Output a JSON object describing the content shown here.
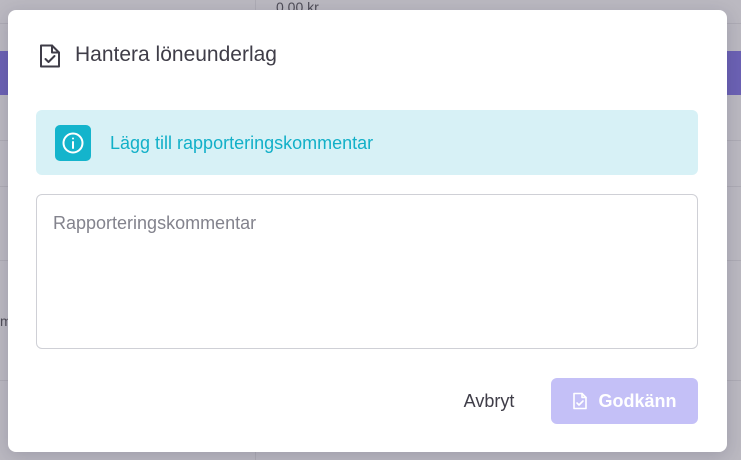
{
  "background": {
    "amount_text": "0,00 kr",
    "partial_text": "m"
  },
  "modal": {
    "title": "Hantera löneunderlag",
    "title_icon": "file-check-icon",
    "info_banner": {
      "icon": "info-circle-icon",
      "text": "Lägg till rapporteringskommentar"
    },
    "comment_field": {
      "placeholder": "Rapporteringskommentar",
      "value": ""
    },
    "buttons": {
      "cancel_label": "Avbryt",
      "approve_label": "Godkänn",
      "approve_icon": "file-check-icon",
      "approve_disabled": true
    }
  },
  "colors": {
    "primary": "#c4c0f7",
    "info_bg": "#d7f1f6",
    "info_accent": "#14b4cc",
    "text": "#3f3d48",
    "backdrop_band": "#6c62b4"
  }
}
